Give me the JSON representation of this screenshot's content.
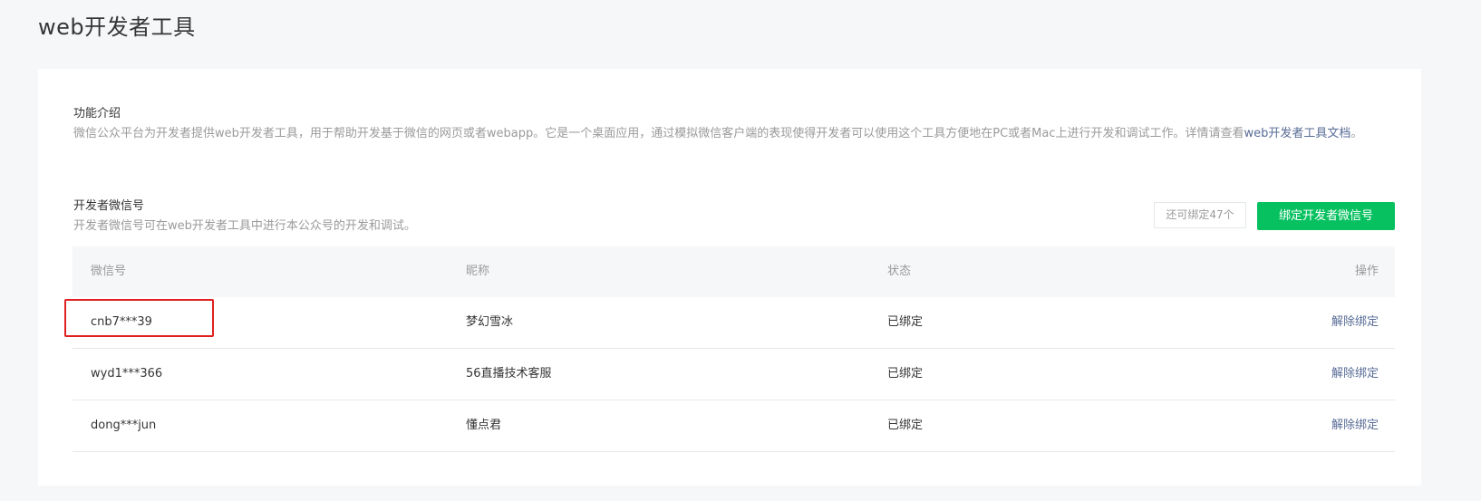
{
  "page": {
    "title": "web开发者工具"
  },
  "intro": {
    "title": "功能介绍",
    "desc_text": "微信公众平台为开发者提供web开发者工具，用于帮助开发基于微信的网页或者webapp。它是一个桌面应用，通过模拟微信客户端的表现使得开发者可以使用这个工具方便地在PC或者Mac上进行开发和调试工作。详情请查看",
    "desc_link": "web开发者工具文档",
    "desc_end": "。"
  },
  "developers": {
    "title": "开发者微信号",
    "desc": "开发者微信号可在web开发者工具中进行本公众号的开发和调试。",
    "remaining_label": "还可绑定47个",
    "bind_button_label": "绑定开发者微信号"
  },
  "table": {
    "headers": [
      "微信号",
      "昵称",
      "状态",
      "操作"
    ],
    "rows": [
      {
        "wechat_id": "cnb7***39",
        "nickname": "梦幻雪冰",
        "status": "已绑定",
        "action": "解除绑定"
      },
      {
        "wechat_id": "wyd1***366",
        "nickname": "56直播技术客服",
        "status": "已绑定",
        "action": "解除绑定"
      },
      {
        "wechat_id": "dong***jun",
        "nickname": "懂点君",
        "status": "已绑定",
        "action": "解除绑定"
      }
    ]
  },
  "colors": {
    "accent_green": "#07c160",
    "link_blue": "#576b95",
    "highlight_red": "#e02020"
  }
}
